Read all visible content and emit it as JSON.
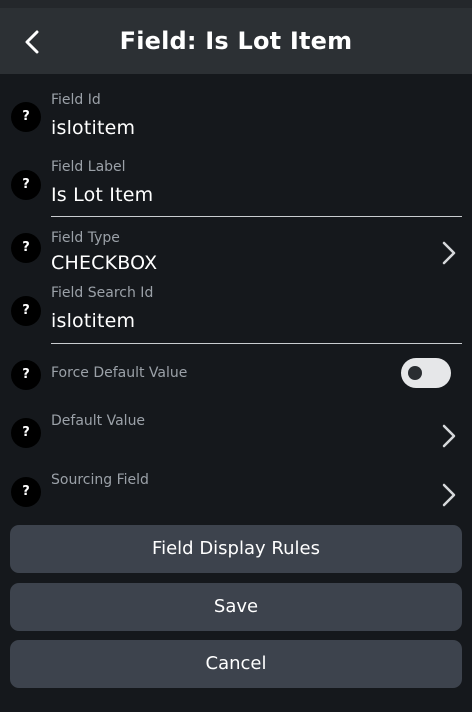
{
  "header": {
    "title": "Field: Is Lot Item",
    "back_icon": "chevron-left-icon"
  },
  "fields": {
    "field_id": {
      "label": "Field Id",
      "value": "islotitem"
    },
    "field_label": {
      "label": "Field Label",
      "value": "Is Lot Item"
    },
    "field_type": {
      "label": "Field Type",
      "value": "CHECKBOX"
    },
    "field_search_id": {
      "label": "Field Search Id",
      "value": "islotitem"
    },
    "force_default_value": {
      "label": "Force Default Value",
      "enabled": false
    },
    "default_value": {
      "label": "Default Value"
    },
    "sourcing_field": {
      "label": "Sourcing Field"
    }
  },
  "help_glyph": "?",
  "buttons": {
    "display_rules": "Field Display Rules",
    "save": "Save",
    "cancel": "Cancel"
  },
  "colors": {
    "background": "#15181c",
    "header": "#2c3034",
    "button": "#3d434d",
    "toggle_track": "#e6e7e9",
    "label": "#9ba1a8"
  }
}
